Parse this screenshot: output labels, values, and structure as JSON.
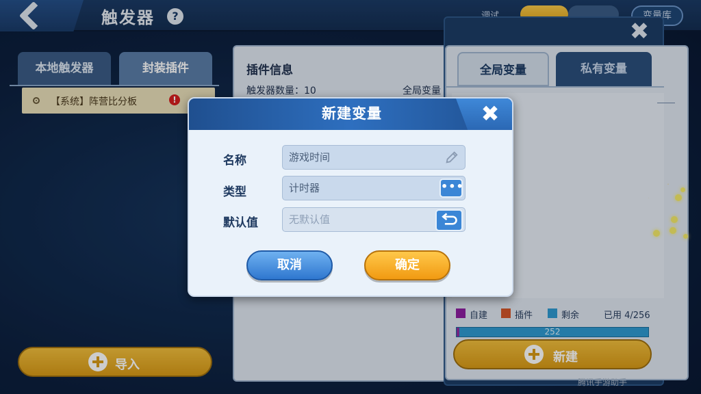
{
  "header": {
    "title": "触发器",
    "help_icon": "?",
    "partial_label": "调试",
    "partial_button": "变量库"
  },
  "left_panel": {
    "tabs": [
      "本地触发器",
      "封装插件"
    ],
    "triggers": [
      {
        "label": "【系统】阵营比分板",
        "warning": "!"
      }
    ],
    "import_label": "导入"
  },
  "info_panel": {
    "title": "插件信息",
    "trigger_count": "触发器数量：10",
    "global_var_partial": "全局变量"
  },
  "var_panel": {
    "tabs": [
      "全局变量",
      "私有变量"
    ],
    "legend": [
      {
        "label": "自建",
        "color": "#8e1fa0"
      },
      {
        "label": "插件",
        "color": "#d2552a"
      },
      {
        "label": "剩余",
        "color": "#2f9ad1"
      }
    ],
    "usage": "已用 4/256",
    "remaining_number": "252",
    "new_label": "新建",
    "close_icon": "✖"
  },
  "dialog": {
    "title": "新建变量",
    "close_icon": "✖",
    "fields": [
      {
        "label": "名称",
        "value": "游戏时间",
        "icon": "pencil-icon"
      },
      {
        "label": "类型",
        "value": "计时器",
        "icon": "dots-icon",
        "button_text": "•••"
      },
      {
        "label": "默认值",
        "value": "无默认值",
        "icon": "reset-icon"
      }
    ],
    "cancel_label": "取消",
    "confirm_label": "确定"
  },
  "watermark": "腾讯手游助手"
}
